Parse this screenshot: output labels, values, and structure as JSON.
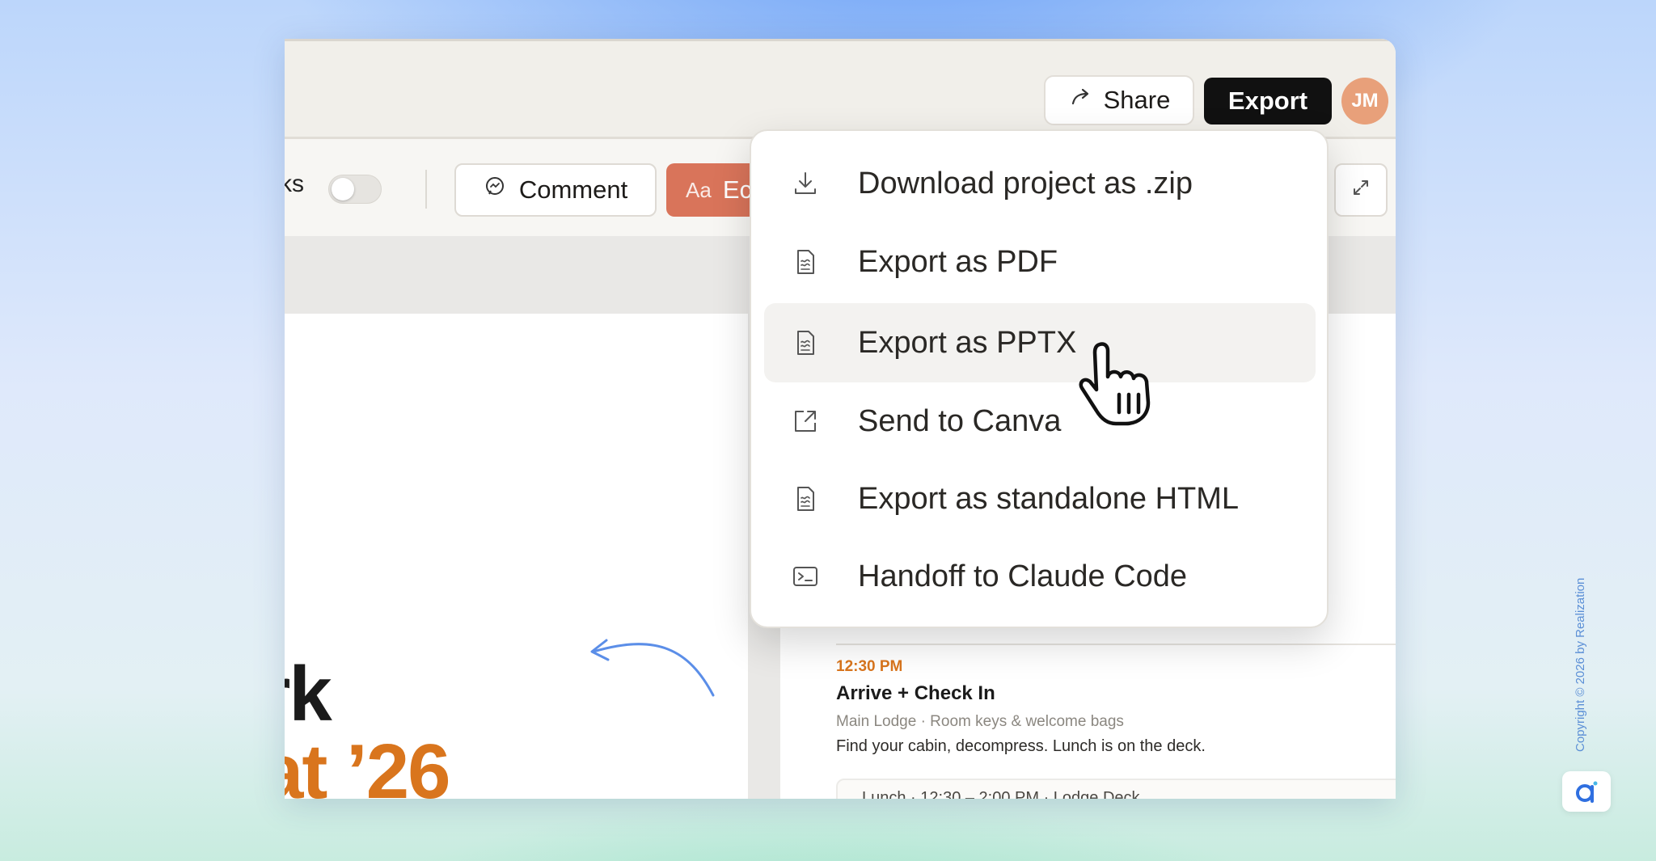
{
  "header": {
    "share_label": "Share",
    "export_label": "Export",
    "avatar_initials": "JM"
  },
  "toolbar": {
    "partial_label": "ks",
    "toggle_state": "off",
    "comment_label": "Comment",
    "edit_icon_text": "Aa",
    "edit_partial_label": "Ec"
  },
  "export_menu": {
    "items": [
      {
        "label": "Download project as .zip",
        "icon": "download-icon"
      },
      {
        "label": "Export as PDF",
        "icon": "document-icon"
      },
      {
        "label": "Export as PPTX",
        "icon": "document-icon",
        "state": "hovered"
      },
      {
        "label": "Send to Canva",
        "icon": "external-link-icon"
      },
      {
        "label": "Export as standalone HTML",
        "icon": "document-icon"
      },
      {
        "label": "Handoff to Claude Code",
        "icon": "terminal-icon"
      }
    ]
  },
  "canvas": {
    "title_line1": "rk",
    "title_line2": "at ’26"
  },
  "schedule": {
    "time": "12:30 PM",
    "event": "Arrive + Check In",
    "location": "Main Lodge · Room keys & welcome bags",
    "description": "Find your cabin, decompress. Lunch is on the deck.",
    "subcard": "Lunch · 12:30 – 2:00 PM · Lodge Deck"
  },
  "watermark": {
    "copyright": "Copyright © 2026 by Realization"
  },
  "colors": {
    "accent_orange": "#d9751d",
    "edit_button": "#d9745a",
    "avatar": "#e8a07a",
    "export_button": "#111111"
  }
}
